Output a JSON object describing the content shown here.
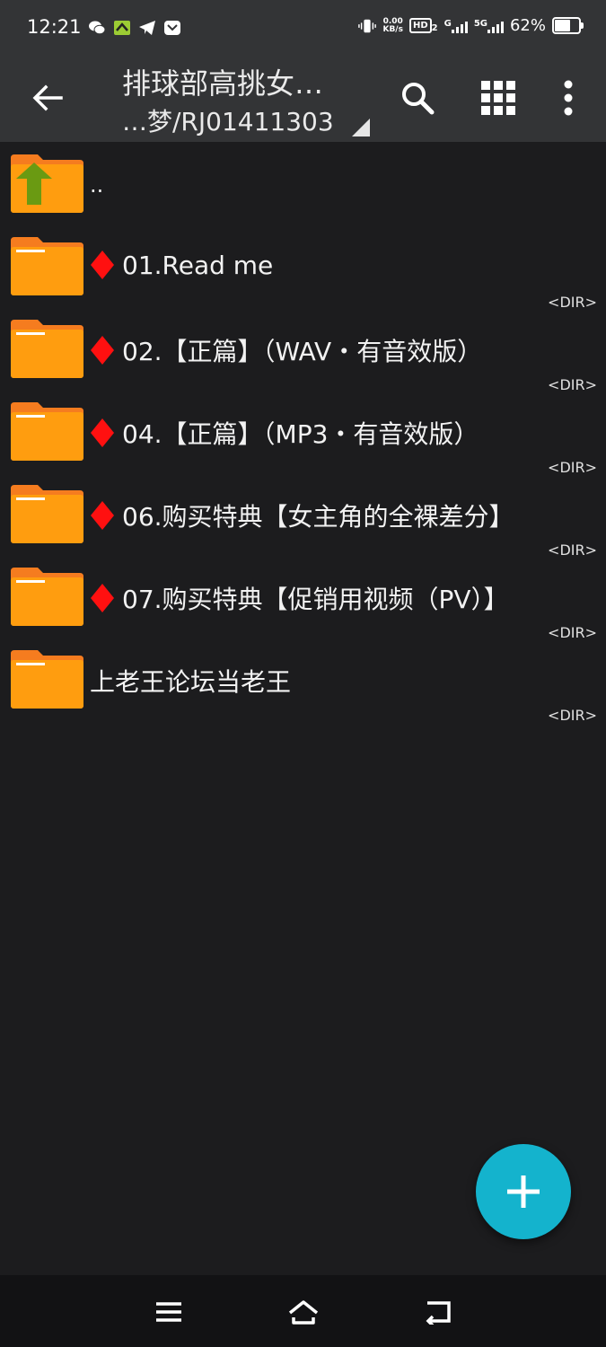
{
  "status_bar": {
    "time": "12:21",
    "net_speed_value": "0.00",
    "net_speed_unit": "KB/s",
    "hd_badge": "HD",
    "hd_sub": "2",
    "signal1_label": "G",
    "signal2_label": "5G",
    "battery_text": "62%",
    "battery_level": 0.62
  },
  "app_bar": {
    "title": "排球部高挑女…",
    "subtitle": "…梦/RJ01411303"
  },
  "files": {
    "parent": {
      "label": ".."
    },
    "items": [
      {
        "label": "01.Read me",
        "type": "<DIR>",
        "marked": true
      },
      {
        "label": "02.【正篇】（WAV・有音效版）",
        "type": "<DIR>",
        "marked": true
      },
      {
        "label": "04.【正篇】（MP3・有音效版）",
        "type": "<DIR>",
        "marked": true
      },
      {
        "label": "06.购买特典【女主角的全裸差分】",
        "type": "<DIR>",
        "marked": true
      },
      {
        "label": "07.购买特典【促销用视频（PV）】",
        "type": "<DIR>",
        "marked": true
      },
      {
        "label": "上老王论坛当老王",
        "type": "<DIR>",
        "marked": false
      }
    ]
  },
  "colors": {
    "folder": "#ff9d0f",
    "folder_tab": "#f57c1f",
    "marker": "#ff1010",
    "fab": "#14b3cd",
    "up_arrow": "#6a9a12"
  },
  "icons": {
    "back": "arrow-left-icon",
    "search": "search-icon",
    "grid": "grid-view-icon",
    "more": "more-vert-icon",
    "add": "plus-icon"
  }
}
